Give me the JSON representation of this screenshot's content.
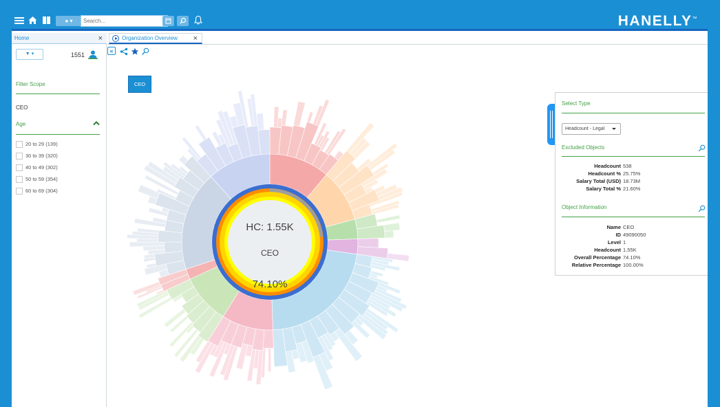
{
  "brand": "HANELLY",
  "colors": {
    "accent": "#1b8fd4",
    "topbar": "#1b8fd4",
    "section_green": "#43a047"
  },
  "topbar": {
    "search_placeholder": "Search..."
  },
  "sidebar": {
    "tab_label": "Home",
    "count": "1551",
    "filter_scope_title": "Filter Scope",
    "filter_scope_value": "CEO",
    "age_title": "Age",
    "age_options": [
      "20 to 29  (139)",
      "30 to 39  (320)",
      "40 to 49  (302)",
      "50 to 59  (354)",
      "60 to 69  (304)"
    ]
  },
  "main": {
    "tab_label": "Organization Overview",
    "breadcrumb_button": "CEO",
    "center": {
      "hc": "HC: 1.55K",
      "name": "CEO",
      "percent": "74.10%"
    }
  },
  "panel": {
    "select_type_title": "Select Type",
    "select_value": "Headcount - Legal",
    "excluded_title": "Excluded Objects",
    "excluded": [
      {
        "k": "Headcount",
        "v": "538"
      },
      {
        "k": "Headcount %",
        "v": "25.75%"
      },
      {
        "k": "Salary Total (USD)",
        "v": "18.73M"
      },
      {
        "k": "Salary Total %",
        "v": "21.60%"
      }
    ],
    "object_info_title": "Object Information",
    "object_info": [
      {
        "k": "Name",
        "v": "CEO"
      },
      {
        "k": "ID",
        "v": "49090050"
      },
      {
        "k": "Level",
        "v": "1"
      },
      {
        "k": "Headcount",
        "v": "1.55K"
      },
      {
        "k": "Overall Percentage",
        "v": "74.10%"
      },
      {
        "k": "Relative Percentage",
        "v": "100.00%"
      }
    ]
  }
}
